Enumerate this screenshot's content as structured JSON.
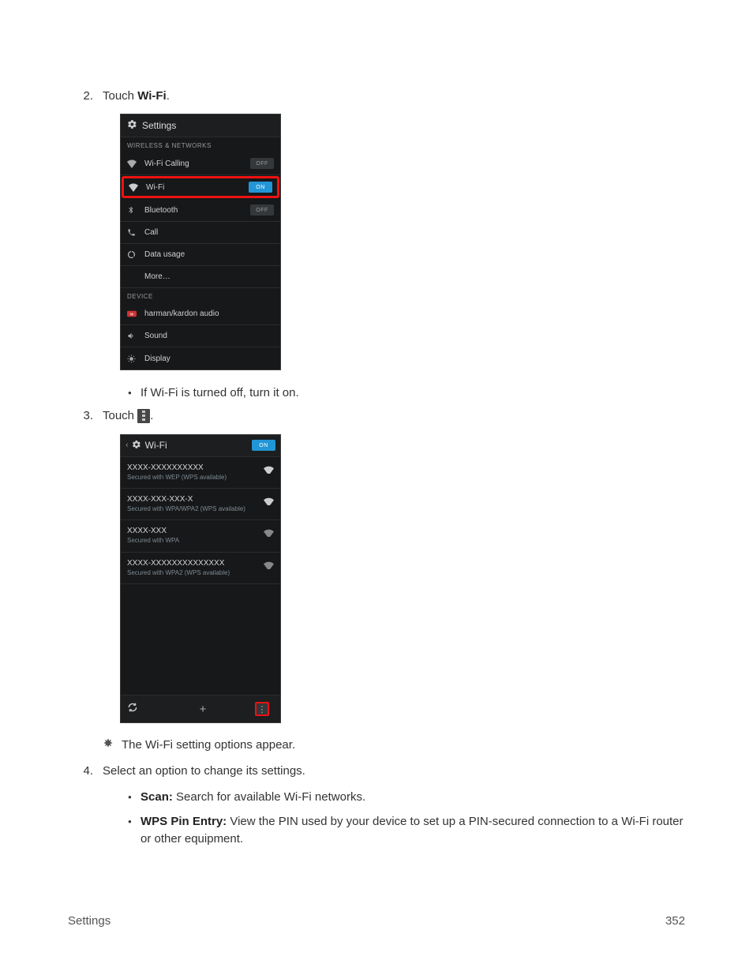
{
  "steps": {
    "s2": {
      "num": "2.",
      "text_a": "Touch ",
      "bold": "Wi-Fi",
      "text_b": "."
    },
    "s2_sub": "If Wi-Fi is turned off, turn it on.",
    "s3": {
      "num": "3.",
      "text_a": "Touch "
    },
    "s3_result": "The Wi-Fi setting options appear.",
    "s4": {
      "num": "4.",
      "text": "Select an option to change its settings."
    },
    "s4_b1": {
      "bold": "Scan:",
      "text": " Search for available Wi-Fi networks."
    },
    "s4_b2": {
      "bold": "WPS Pin Entry:",
      "text": " View the PIN used by your device to set up a PIN-secured connection to a Wi-Fi router or other equipment."
    }
  },
  "phone1": {
    "title": "Settings",
    "section1": "WIRELESS & NETWORKS",
    "rows": {
      "wificalling": {
        "label": "Wi-Fi Calling",
        "toggle": "OFF"
      },
      "wifi": {
        "label": "Wi-Fi",
        "toggle": "ON"
      },
      "bt": {
        "label": "Bluetooth",
        "toggle": "OFF"
      },
      "call": {
        "label": "Call"
      },
      "data": {
        "label": "Data usage"
      },
      "more": {
        "label": "More…"
      }
    },
    "section2": "DEVICE",
    "rows2": {
      "hk": {
        "label": "harman/kardon audio"
      },
      "sound": {
        "label": "Sound"
      },
      "display": {
        "label": "Display"
      }
    }
  },
  "phone2": {
    "title": "Wi-Fi",
    "toggle": "ON",
    "nets": [
      {
        "ssid": "XXXX-XXXXXXXXXX",
        "sec": "Secured with WEP (WPS available)"
      },
      {
        "ssid": "XXXX-XXX-XXX-X",
        "sec": "Secured with WPA/WPA2 (WPS available)"
      },
      {
        "ssid": "XXXX-XXX",
        "sec": "Secured with WPA"
      },
      {
        "ssid": "XXXX-XXXXXXXXXXXXXX",
        "sec": "Secured with WPA2 (WPS available)"
      }
    ],
    "bottom": {
      "wps": "⟳",
      "add": "+",
      "menu": "⋮"
    }
  },
  "footer": {
    "left": "Settings",
    "right": "352"
  }
}
